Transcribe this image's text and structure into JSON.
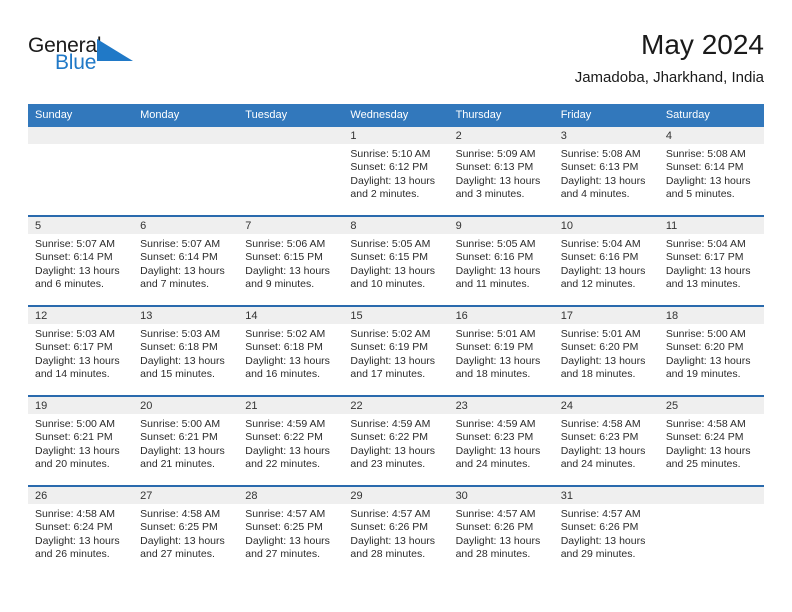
{
  "logo": {
    "word_general": "General",
    "word_blue": "Blue",
    "triangle_color": "#2079c7"
  },
  "header": {
    "month_title": "May 2024",
    "location": "Jamadoba, Jharkhand, India"
  },
  "theme": {
    "header_blue": "#3278bc",
    "row_divider_blue": "#2a6aad",
    "daynum_bar_gray": "#efefef"
  },
  "weekday_headers": [
    "Sunday",
    "Monday",
    "Tuesday",
    "Wednesday",
    "Thursday",
    "Friday",
    "Saturday"
  ],
  "weeks": [
    [
      {
        "day": "",
        "sunrise": "",
        "sunset": "",
        "daylight1": "",
        "daylight2": "",
        "empty": true
      },
      {
        "day": "",
        "sunrise": "",
        "sunset": "",
        "daylight1": "",
        "daylight2": "",
        "empty": true
      },
      {
        "day": "",
        "sunrise": "",
        "sunset": "",
        "daylight1": "",
        "daylight2": "",
        "empty": true
      },
      {
        "day": "1",
        "sunrise": "Sunrise: 5:10 AM",
        "sunset": "Sunset: 6:12 PM",
        "daylight1": "Daylight: 13 hours",
        "daylight2": "and 2 minutes."
      },
      {
        "day": "2",
        "sunrise": "Sunrise: 5:09 AM",
        "sunset": "Sunset: 6:13 PM",
        "daylight1": "Daylight: 13 hours",
        "daylight2": "and 3 minutes."
      },
      {
        "day": "3",
        "sunrise": "Sunrise: 5:08 AM",
        "sunset": "Sunset: 6:13 PM",
        "daylight1": "Daylight: 13 hours",
        "daylight2": "and 4 minutes."
      },
      {
        "day": "4",
        "sunrise": "Sunrise: 5:08 AM",
        "sunset": "Sunset: 6:14 PM",
        "daylight1": "Daylight: 13 hours",
        "daylight2": "and 5 minutes."
      }
    ],
    [
      {
        "day": "5",
        "sunrise": "Sunrise: 5:07 AM",
        "sunset": "Sunset: 6:14 PM",
        "daylight1": "Daylight: 13 hours",
        "daylight2": "and 6 minutes."
      },
      {
        "day": "6",
        "sunrise": "Sunrise: 5:07 AM",
        "sunset": "Sunset: 6:14 PM",
        "daylight1": "Daylight: 13 hours",
        "daylight2": "and 7 minutes."
      },
      {
        "day": "7",
        "sunrise": "Sunrise: 5:06 AM",
        "sunset": "Sunset: 6:15 PM",
        "daylight1": "Daylight: 13 hours",
        "daylight2": "and 9 minutes."
      },
      {
        "day": "8",
        "sunrise": "Sunrise: 5:05 AM",
        "sunset": "Sunset: 6:15 PM",
        "daylight1": "Daylight: 13 hours",
        "daylight2": "and 10 minutes."
      },
      {
        "day": "9",
        "sunrise": "Sunrise: 5:05 AM",
        "sunset": "Sunset: 6:16 PM",
        "daylight1": "Daylight: 13 hours",
        "daylight2": "and 11 minutes."
      },
      {
        "day": "10",
        "sunrise": "Sunrise: 5:04 AM",
        "sunset": "Sunset: 6:16 PM",
        "daylight1": "Daylight: 13 hours",
        "daylight2": "and 12 minutes."
      },
      {
        "day": "11",
        "sunrise": "Sunrise: 5:04 AM",
        "sunset": "Sunset: 6:17 PM",
        "daylight1": "Daylight: 13 hours",
        "daylight2": "and 13 minutes."
      }
    ],
    [
      {
        "day": "12",
        "sunrise": "Sunrise: 5:03 AM",
        "sunset": "Sunset: 6:17 PM",
        "daylight1": "Daylight: 13 hours",
        "daylight2": "and 14 minutes."
      },
      {
        "day": "13",
        "sunrise": "Sunrise: 5:03 AM",
        "sunset": "Sunset: 6:18 PM",
        "daylight1": "Daylight: 13 hours",
        "daylight2": "and 15 minutes."
      },
      {
        "day": "14",
        "sunrise": "Sunrise: 5:02 AM",
        "sunset": "Sunset: 6:18 PM",
        "daylight1": "Daylight: 13 hours",
        "daylight2": "and 16 minutes."
      },
      {
        "day": "15",
        "sunrise": "Sunrise: 5:02 AM",
        "sunset": "Sunset: 6:19 PM",
        "daylight1": "Daylight: 13 hours",
        "daylight2": "and 17 minutes."
      },
      {
        "day": "16",
        "sunrise": "Sunrise: 5:01 AM",
        "sunset": "Sunset: 6:19 PM",
        "daylight1": "Daylight: 13 hours",
        "daylight2": "and 18 minutes."
      },
      {
        "day": "17",
        "sunrise": "Sunrise: 5:01 AM",
        "sunset": "Sunset: 6:20 PM",
        "daylight1": "Daylight: 13 hours",
        "daylight2": "and 18 minutes."
      },
      {
        "day": "18",
        "sunrise": "Sunrise: 5:00 AM",
        "sunset": "Sunset: 6:20 PM",
        "daylight1": "Daylight: 13 hours",
        "daylight2": "and 19 minutes."
      }
    ],
    [
      {
        "day": "19",
        "sunrise": "Sunrise: 5:00 AM",
        "sunset": "Sunset: 6:21 PM",
        "daylight1": "Daylight: 13 hours",
        "daylight2": "and 20 minutes."
      },
      {
        "day": "20",
        "sunrise": "Sunrise: 5:00 AM",
        "sunset": "Sunset: 6:21 PM",
        "daylight1": "Daylight: 13 hours",
        "daylight2": "and 21 minutes."
      },
      {
        "day": "21",
        "sunrise": "Sunrise: 4:59 AM",
        "sunset": "Sunset: 6:22 PM",
        "daylight1": "Daylight: 13 hours",
        "daylight2": "and 22 minutes."
      },
      {
        "day": "22",
        "sunrise": "Sunrise: 4:59 AM",
        "sunset": "Sunset: 6:22 PM",
        "daylight1": "Daylight: 13 hours",
        "daylight2": "and 23 minutes."
      },
      {
        "day": "23",
        "sunrise": "Sunrise: 4:59 AM",
        "sunset": "Sunset: 6:23 PM",
        "daylight1": "Daylight: 13 hours",
        "daylight2": "and 24 minutes."
      },
      {
        "day": "24",
        "sunrise": "Sunrise: 4:58 AM",
        "sunset": "Sunset: 6:23 PM",
        "daylight1": "Daylight: 13 hours",
        "daylight2": "and 24 minutes."
      },
      {
        "day": "25",
        "sunrise": "Sunrise: 4:58 AM",
        "sunset": "Sunset: 6:24 PM",
        "daylight1": "Daylight: 13 hours",
        "daylight2": "and 25 minutes."
      }
    ],
    [
      {
        "day": "26",
        "sunrise": "Sunrise: 4:58 AM",
        "sunset": "Sunset: 6:24 PM",
        "daylight1": "Daylight: 13 hours",
        "daylight2": "and 26 minutes."
      },
      {
        "day": "27",
        "sunrise": "Sunrise: 4:58 AM",
        "sunset": "Sunset: 6:25 PM",
        "daylight1": "Daylight: 13 hours",
        "daylight2": "and 27 minutes."
      },
      {
        "day": "28",
        "sunrise": "Sunrise: 4:57 AM",
        "sunset": "Sunset: 6:25 PM",
        "daylight1": "Daylight: 13 hours",
        "daylight2": "and 27 minutes."
      },
      {
        "day": "29",
        "sunrise": "Sunrise: 4:57 AM",
        "sunset": "Sunset: 6:26 PM",
        "daylight1": "Daylight: 13 hours",
        "daylight2": "and 28 minutes."
      },
      {
        "day": "30",
        "sunrise": "Sunrise: 4:57 AM",
        "sunset": "Sunset: 6:26 PM",
        "daylight1": "Daylight: 13 hours",
        "daylight2": "and 28 minutes."
      },
      {
        "day": "31",
        "sunrise": "Sunrise: 4:57 AM",
        "sunset": "Sunset: 6:26 PM",
        "daylight1": "Daylight: 13 hours",
        "daylight2": "and 29 minutes."
      },
      {
        "day": "",
        "sunrise": "",
        "sunset": "",
        "daylight1": "",
        "daylight2": "",
        "empty": true
      }
    ]
  ]
}
